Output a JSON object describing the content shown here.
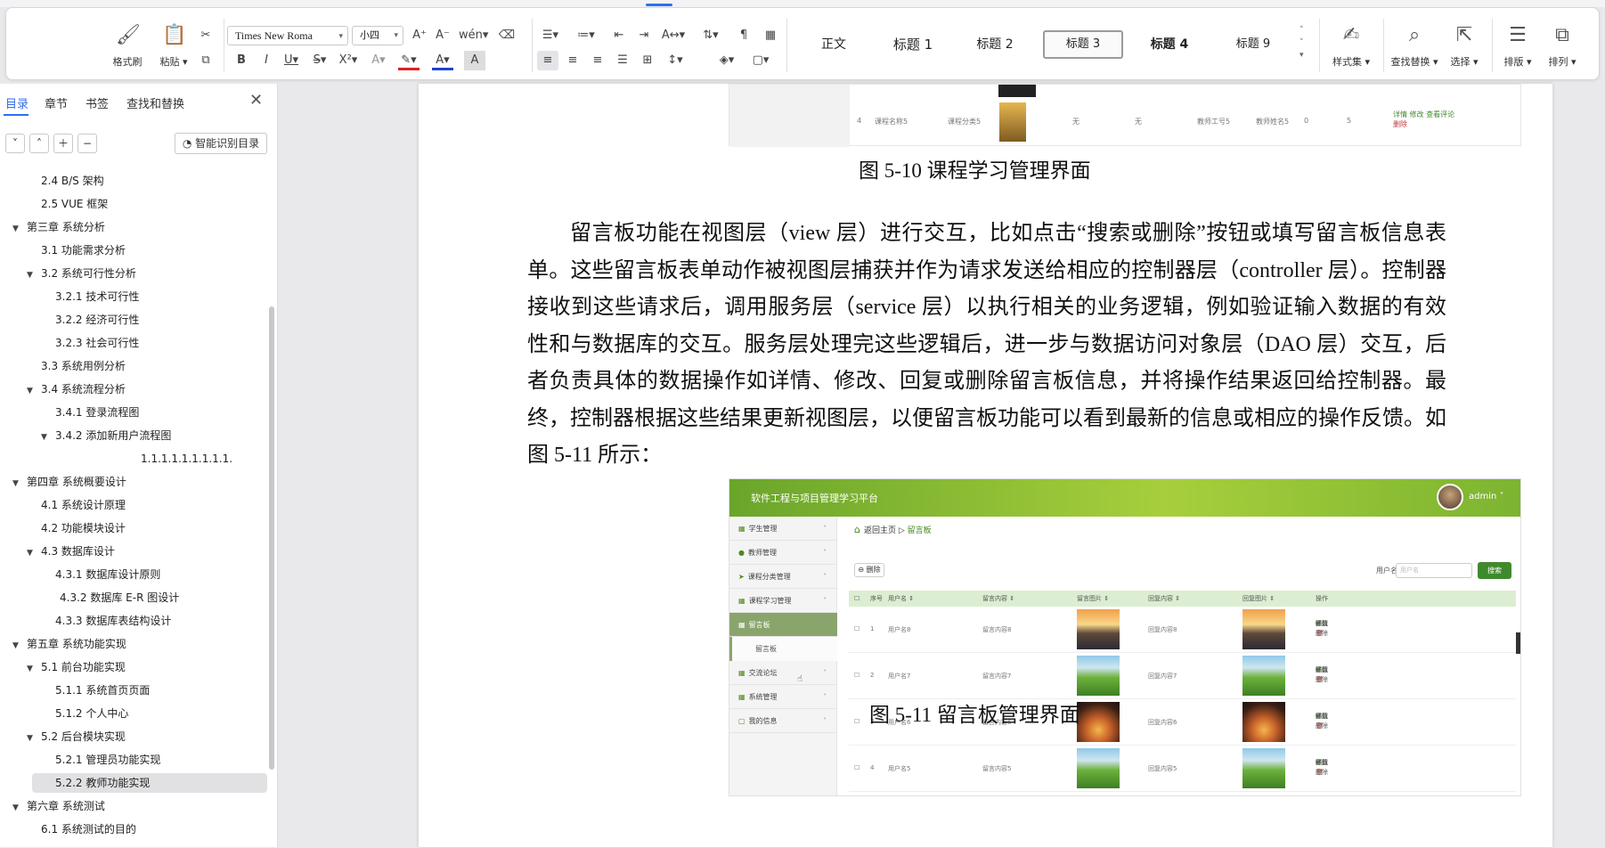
{
  "ribbon": {
    "clipboard": {
      "format_painter": "格式刷",
      "paste": "粘贴"
    },
    "font": {
      "name": "Times New Roma",
      "size": "小四"
    },
    "styles": [
      "正文",
      "标题 1",
      "标题 2",
      "标题 3",
      "标题 4",
      "标题 9"
    ],
    "active_style": "标题 3",
    "style_set": "样式集",
    "find_replace": "查找替换",
    "select": "选择",
    "layout": "排版",
    "arrange": "排列"
  },
  "nav": {
    "tabs": [
      "目录",
      "章节",
      "书签",
      "查找和替换"
    ],
    "smart_toc": "智能识别目录",
    "toc": [
      {
        "text": "2.4 B/S 架构",
        "indent": 1,
        "arrow": ""
      },
      {
        "text": "2.5 VUE 框架",
        "indent": 1,
        "arrow": ""
      },
      {
        "text": "第三章  系统分析",
        "indent": 0,
        "arrow": "▼"
      },
      {
        "text": "3.1 功能需求分析",
        "indent": 1,
        "arrow": ""
      },
      {
        "text": "3.2 系统可行性分析",
        "indent": 1,
        "arrow": "▼"
      },
      {
        "text": "3.2.1 技术可行性",
        "indent": 2,
        "arrow": ""
      },
      {
        "text": "3.2.2  经济可行性",
        "indent": 2,
        "arrow": ""
      },
      {
        "text": "3.2.3 社会可行性",
        "indent": 2,
        "arrow": ""
      },
      {
        "text": "3.3  系统用例分析",
        "indent": 1,
        "arrow": ""
      },
      {
        "text": "3.4 系统流程分析",
        "indent": 1,
        "arrow": "▼"
      },
      {
        "text": "3.4.1  登录流程图",
        "indent": 2,
        "arrow": ""
      },
      {
        "text": "3.4.2  添加新用户流程图",
        "indent": 2,
        "arrow": "▼"
      },
      {
        "text": "1.1.1.1.1.1.1.1.1.",
        "indent": 4,
        "arrow": ""
      },
      {
        "text": "第四章  系统概要设计",
        "indent": 0,
        "arrow": "▼"
      },
      {
        "text": "4.1 系统设计原理",
        "indent": 1,
        "arrow": ""
      },
      {
        "text": "4.2 功能模块设计",
        "indent": 1,
        "arrow": ""
      },
      {
        "text": "4.3  数据库设计",
        "indent": 1,
        "arrow": "▼"
      },
      {
        "text": "4.3.1 数据库设计原则",
        "indent": 2,
        "arrow": ""
      },
      {
        "text": "4.3.2 数据库 E-R 图设计",
        "indent": 2.3,
        "arrow": ""
      },
      {
        "text": "4.3.3 数据库表结构设计",
        "indent": 2,
        "arrow": ""
      },
      {
        "text": "第五章  系统功能实现",
        "indent": 0,
        "arrow": "▼"
      },
      {
        "text": "5.1 前台功能实现",
        "indent": 1,
        "arrow": "▼"
      },
      {
        "text": "5.1.1 系统首页页面",
        "indent": 2,
        "arrow": ""
      },
      {
        "text": "5.1.2 个人中心",
        "indent": 2,
        "arrow": ""
      },
      {
        "text": "5.2 后台模块实现",
        "indent": 1,
        "arrow": "▼"
      },
      {
        "text": "5.2.1 管理员功能实现",
        "indent": 2,
        "arrow": ""
      },
      {
        "text": "5.2.2 教师功能实现",
        "indent": 2,
        "arrow": "",
        "selected": true
      },
      {
        "text": "第六章  系统测试",
        "indent": 0,
        "arrow": "▼"
      },
      {
        "text": "6.1 系统测试的目的",
        "indent": 1,
        "arrow": ""
      }
    ]
  },
  "doc": {
    "fig1_row": {
      "num": "4",
      "name": "课程名称5",
      "category": "课程分类5",
      "a": "无",
      "b": "无",
      "teacher_no": "教师工号5",
      "teacher_name": "教师姓名5",
      "c": "0",
      "d": "5",
      "op1": "详情",
      "op2": "修改",
      "op3": "查看评论",
      "op4": "删除"
    },
    "fig1_caption": "图 5-10 课程学习管理界面",
    "paragraph": "留言板功能在视图层（view 层）进行交互，比如点击“搜索或删除”按钮或填写留言板信息表单。这些留言板表单动作被视图层捕获并作为请求发送给相应的控制器层（controller 层）。控制器接收到这些请求后，调用服务层（service 层）以执行相关的业务逻辑，例如验证输入数据的有效性和与数据库的交互。服务层处理完这些逻辑后，进一步与数据访问对象层（DAO 层）交互，后者负责具体的数据操作如详情、修改、回复或删除留言板信息，并将操作结果返回给控制器。最终，控制器根据这些结果更新视图层，以便留言板功能可以看到最新的信息或相应的操作反馈。如图 5-11 所示：",
    "fig2_caption": "图 5-11 留言板管理界面",
    "app": {
      "title": "软件工程与项目管理学习平台",
      "user": "admin ˅",
      "menu": [
        "学生管理",
        "教师管理",
        "课程分类管理",
        "课程学习管理",
        "留言板",
        "交流论坛",
        "系统管理",
        "我的信息"
      ],
      "submenu": "留言板",
      "breadcrumb_home": "返回主页",
      "breadcrumb_current": "留言板",
      "delete_btn": "删除",
      "search_label": "用户名",
      "search_placeholder": "用户名",
      "search_btn": "搜索",
      "headers": [
        "序号",
        "用户名 ⇕",
        "留言内容 ⇕",
        "留言图片 ⇕",
        "回复内容 ⇕",
        "回复图片 ⇕",
        "操作"
      ],
      "rows": [
        {
          "num": "1",
          "user": "用户名8",
          "msg": "留言内容8",
          "reply": "回复内容8",
          "img": "sunset"
        },
        {
          "num": "2",
          "user": "用户名7",
          "msg": "留言内容7",
          "reply": "回复内容7",
          "img": "hills"
        },
        {
          "num": "3",
          "user": "用户名6",
          "msg": "留言内容6",
          "reply": "回复内容6",
          "img": "palm"
        },
        {
          "num": "4",
          "user": "用户名5",
          "msg": "留言内容5",
          "reply": "回复内容5",
          "img": "hills"
        }
      ],
      "ops": [
        "详情",
        "修改",
        "回复",
        "删除"
      ]
    }
  }
}
